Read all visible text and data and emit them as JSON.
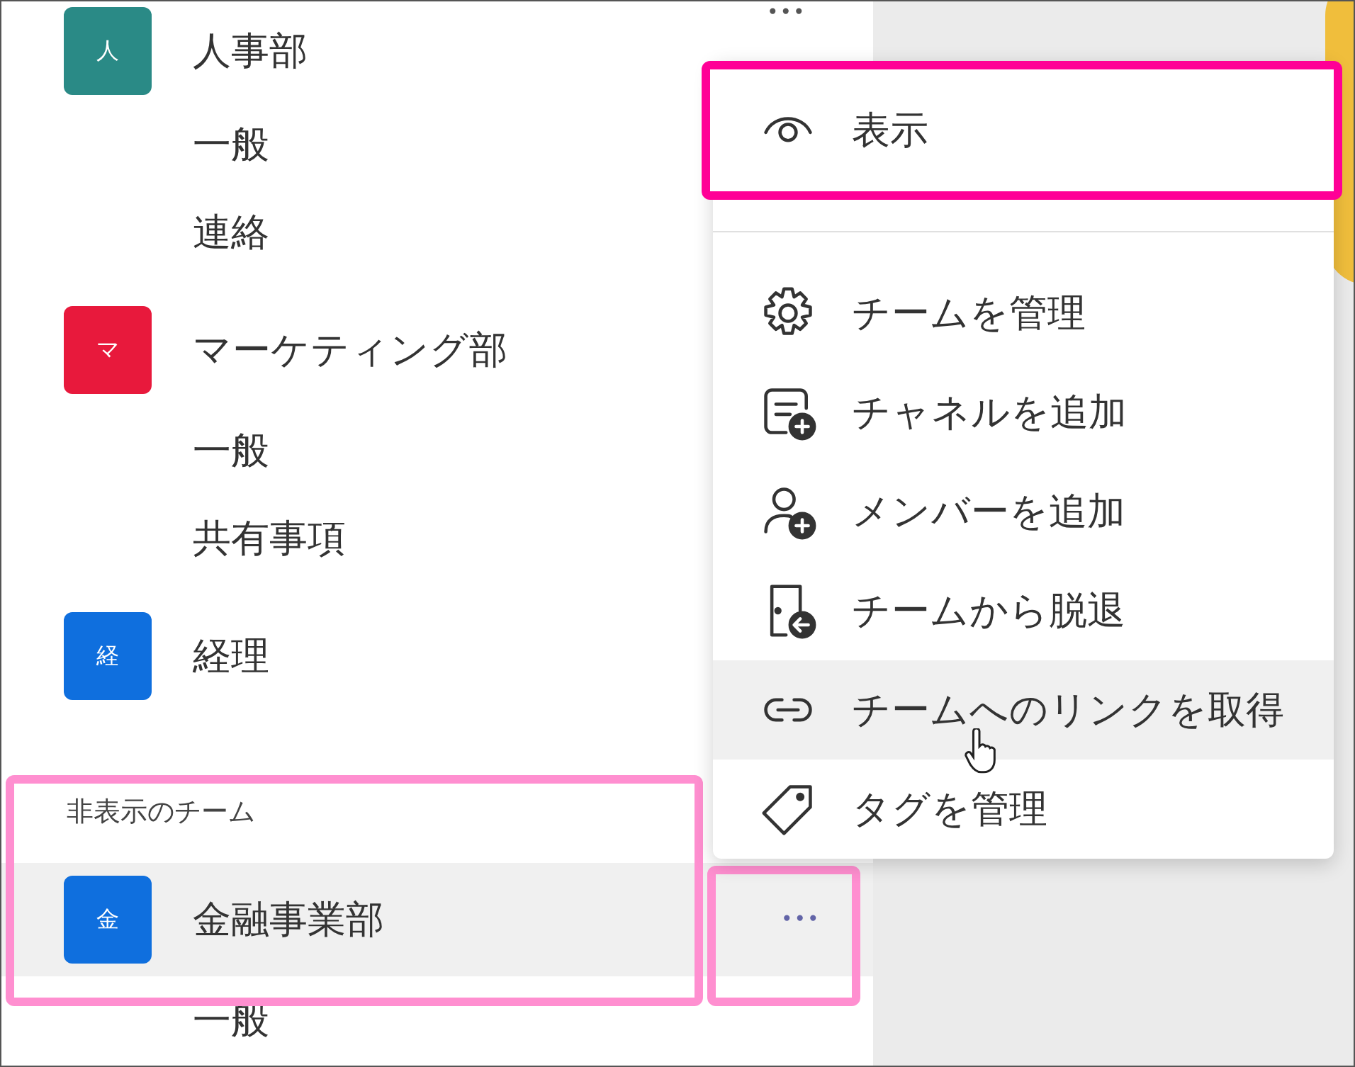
{
  "sidebar": {
    "teams": [
      {
        "initial": "人",
        "name": "人事部",
        "color": "#2a8a86",
        "more": "•••",
        "channels": [
          "一般",
          "連絡"
        ]
      },
      {
        "initial": "マ",
        "name": "マーケティング部",
        "color": "#e8193c",
        "channels": [
          "一般",
          "共有事項"
        ]
      },
      {
        "initial": "経",
        "name": "経理",
        "color": "#0f6fde"
      }
    ]
  },
  "hidden_section": {
    "title": "非表示のチーム",
    "highlighted": true,
    "teams": [
      {
        "initial": "金",
        "name": "金融事業部",
        "color": "#0f6fde",
        "selected": true,
        "more": "•••",
        "more_highlighted": true,
        "channels": [
          "一般"
        ]
      }
    ]
  },
  "context_menu": {
    "items": [
      {
        "kind": "view",
        "label": "表示",
        "highlighted": true,
        "hovered": false
      },
      {
        "kind": "manage",
        "label": "チームを管理",
        "highlighted": false,
        "hovered": false
      },
      {
        "kind": "channel",
        "label": "チャネルを追加",
        "highlighted": false,
        "hovered": false
      },
      {
        "kind": "member",
        "label": "メンバーを追加",
        "highlighted": false,
        "hovered": false
      },
      {
        "kind": "leave",
        "label": "チームから脱退",
        "highlighted": false,
        "hovered": false
      },
      {
        "kind": "link",
        "label": "チームへのリンクを取得",
        "highlighted": false,
        "hovered": true
      },
      {
        "kind": "tag",
        "label": "タグを管理",
        "highlighted": false,
        "hovered": false
      }
    ]
  }
}
